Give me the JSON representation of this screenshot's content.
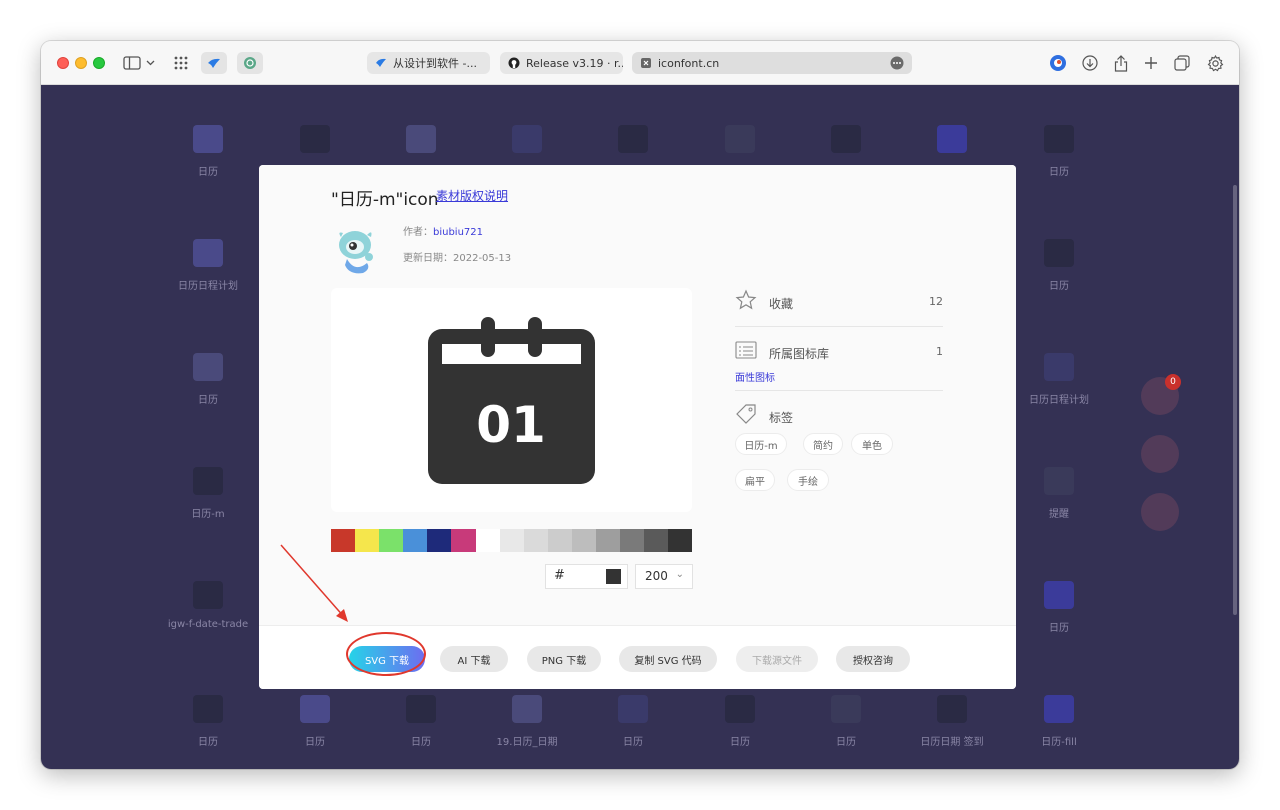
{
  "browser": {
    "tabs": [
      {
        "label": "从设计到软件 -...",
        "favicon": "yuque-icon"
      },
      {
        "label": "Release v3.19 · r...",
        "favicon": "github-icon"
      },
      {
        "label": "iconfont.cn",
        "favicon": "page-icon"
      }
    ]
  },
  "background_grid": {
    "labels": [
      "日历",
      "",
      "",
      "",
      "",
      "",
      "",
      "",
      "日历",
      "日历日程计划",
      "日历",
      "日历",
      "日历日程计划",
      "日历-m",
      "提醒",
      "igw-f-date-trade",
      "日历",
      "日历",
      "日历",
      "日历",
      "19.日历_日期",
      "日历",
      "日历",
      "日历",
      "日历日期 签到",
      "日历-fill"
    ],
    "badge_count": "0"
  },
  "modal": {
    "title": "\"日历-m\"icon",
    "copyright_link": "素材版权说明",
    "author_label": "作者：",
    "author_name": "biubiu721",
    "date_label": "更新日期：",
    "date_value": "2022-05-13",
    "preview_number": "01",
    "palette": [
      "#c8382a",
      "#f5e64c",
      "#7be16a",
      "#4a90d9",
      "#1e2a7a",
      "#c83a7a",
      "#ffffff",
      "#e8e8e8",
      "#dadada",
      "#cccccc",
      "#bdbdbd",
      "#9e9e9e",
      "#7a7a7a",
      "#5a5a5a",
      "#333333"
    ],
    "hex_prefix": "#",
    "hex_value": "",
    "color": "#333333",
    "size": "200",
    "favorites_label": "收藏",
    "favorites_count": "12",
    "library_label": "所属图标库",
    "library_count": "1",
    "library_link": "面性图标",
    "tags_label": "标签",
    "tags": [
      "日历-m",
      "简约",
      "单色",
      "扁平",
      "手绘"
    ],
    "buttons": {
      "svg": "SVG 下载",
      "ai": "AI 下载",
      "png": "PNG 下载",
      "copy_svg": "复制 SVG 代码",
      "source": "下载源文件",
      "license": "授权咨询"
    }
  },
  "colors": {
    "overlay_bg": "#343154",
    "accent_link": "#3a3ad8",
    "highlight": "#e0382d"
  }
}
